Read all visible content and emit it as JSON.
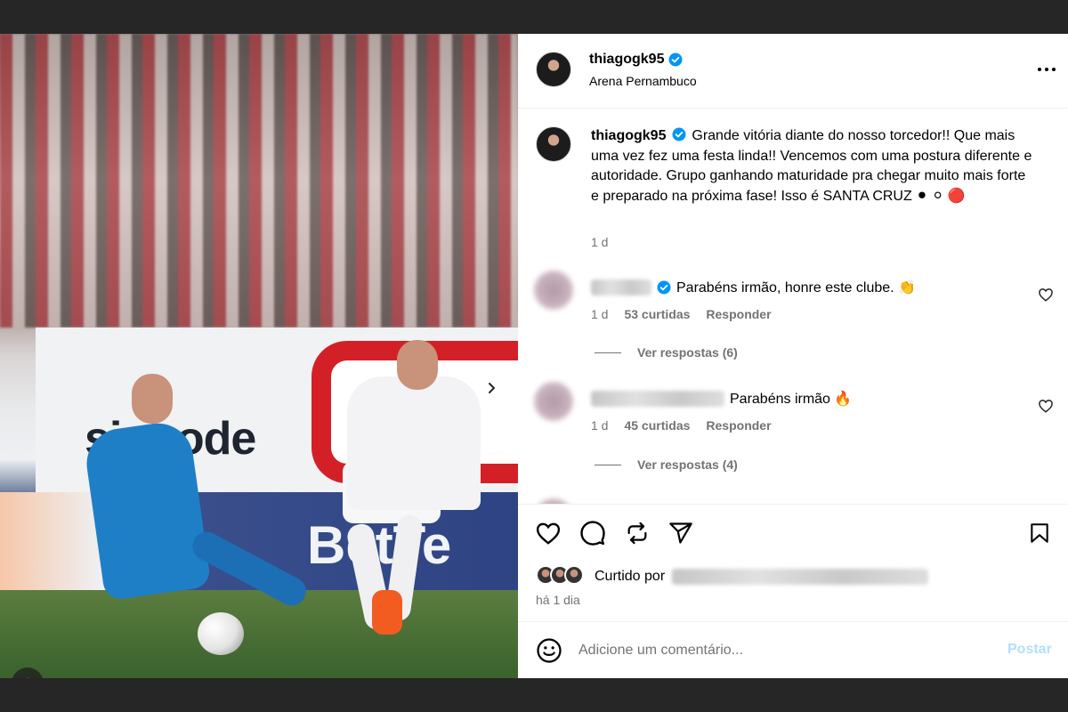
{
  "post": {
    "username": "thiagogk95",
    "location": "Arena Pernambuco",
    "caption": "Grande vitória diante do nosso torcedor!! Que mais uma vez fez uma festa linda!! Vencemos com uma postura diferente e autoridade. Grupo ganhando maturidade pra chegar muito mais forte e preparado na próxima fase! Isso é SANTA CRUZ ⚫ ⚪ 🔴",
    "caption_age": "1 d",
    "photo_banner_text": "sjogode",
    "photo_ad_text": "BetTe"
  },
  "comments": [
    {
      "text": "Parabéns irmão, honre este clube. 👏",
      "age": "1 d",
      "likes": "53 curtidas",
      "reply_label": "Responder",
      "view_replies": "Ver respostas (6)"
    },
    {
      "text": "Parabéns irmão 🔥",
      "age": "1 d",
      "likes": "45 curtidas",
      "reply_label": "Responder",
      "view_replies": "Ver respostas (4)"
    }
  ],
  "actions": {
    "liked_by_label": "Curtido por",
    "time_ago": "há 1 dia"
  },
  "composer": {
    "placeholder": "Adicione um comentário...",
    "post_label": "Postar"
  },
  "carousel": {
    "total": 4,
    "active_index": 0
  },
  "colors": {
    "verified": "#0095f6",
    "post_button": "#b2dffc",
    "muted_text": "#737373",
    "divider": "#efefef"
  },
  "icons": [
    "more-options-icon",
    "verified-icon",
    "like-icon",
    "comment-icon",
    "share-icon",
    "send-icon",
    "save-icon",
    "emoji-icon",
    "chevron-right-icon",
    "user-tag-icon"
  ]
}
